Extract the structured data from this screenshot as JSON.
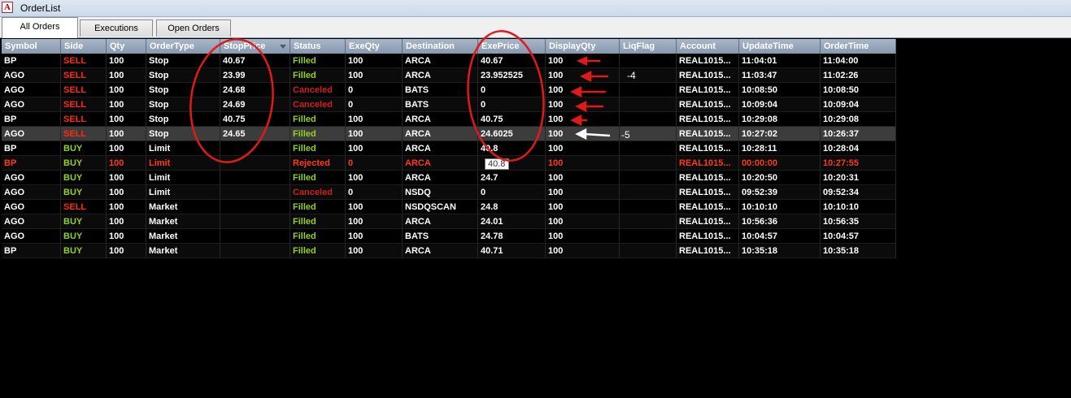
{
  "window": {
    "title": "OrderList"
  },
  "tabs": [
    "All Orders",
    "Executions",
    "Open Orders"
  ],
  "columns": [
    "Symbol",
    "Side",
    "Qty",
    "OrderType",
    "StopPrice",
    "Status",
    "ExeQty",
    "Destination",
    "ExePrice",
    "DisplayQty",
    "LiqFlag",
    "Account",
    "UpdateTime",
    "OrderTime"
  ],
  "rows": [
    {
      "symbol": "BP",
      "side": "SELL",
      "qty": "100",
      "ordertype": "Stop",
      "stopprice": "40.67",
      "status": "Filled",
      "exeqty": "100",
      "destination": "ARCA",
      "exeprice": "40.67",
      "displayqty": "100",
      "liqflag": "",
      "account": "REAL1015...",
      "updatetime": "11:04:01",
      "ordertime": "11:04:00"
    },
    {
      "symbol": "AGO",
      "side": "SELL",
      "qty": "100",
      "ordertype": "Stop",
      "stopprice": "23.99",
      "status": "Filled",
      "exeqty": "100",
      "destination": "ARCA",
      "exeprice": "23.952525",
      "displayqty": "100",
      "liqflag": "",
      "account": "REAL1015...",
      "updatetime": "11:03:47",
      "ordertime": "11:02:26"
    },
    {
      "symbol": "AGO",
      "side": "SELL",
      "qty": "100",
      "ordertype": "Stop",
      "stopprice": "24.68",
      "status": "Canceled",
      "exeqty": "0",
      "destination": "BATS",
      "exeprice": "0",
      "displayqty": "100",
      "liqflag": "",
      "account": "REAL1015...",
      "updatetime": "10:08:50",
      "ordertime": "10:08:50"
    },
    {
      "symbol": "AGO",
      "side": "SELL",
      "qty": "100",
      "ordertype": "Stop",
      "stopprice": "24.69",
      "status": "Canceled",
      "exeqty": "0",
      "destination": "BATS",
      "exeprice": "0",
      "displayqty": "100",
      "liqflag": "",
      "account": "REAL1015...",
      "updatetime": "10:09:04",
      "ordertime": "10:09:04"
    },
    {
      "symbol": "BP",
      "side": "SELL",
      "qty": "100",
      "ordertype": "Stop",
      "stopprice": "40.75",
      "status": "Filled",
      "exeqty": "100",
      "destination": "ARCA",
      "exeprice": "40.75",
      "displayqty": "100",
      "liqflag": "",
      "account": "REAL1015...",
      "updatetime": "10:29:08",
      "ordertime": "10:29:08"
    },
    {
      "symbol": "AGO",
      "side": "SELL",
      "qty": "100",
      "ordertype": "Stop",
      "stopprice": "24.65",
      "status": "Filled",
      "exeqty": "100",
      "destination": "ARCA",
      "exeprice": "24.6025",
      "displayqty": "100",
      "liqflag": "",
      "account": "REAL1015...",
      "updatetime": "10:27:02",
      "ordertime": "10:26:37"
    },
    {
      "symbol": "BP",
      "side": "BUY",
      "qty": "100",
      "ordertype": "Limit",
      "stopprice": "",
      "status": "Filled",
      "exeqty": "100",
      "destination": "ARCA",
      "exeprice": "40.8",
      "displayqty": "100",
      "liqflag": "",
      "account": "REAL1015...",
      "updatetime": "10:28:11",
      "ordertime": "10:28:04"
    },
    {
      "symbol": "BP",
      "side": "BUY",
      "qty": "100",
      "ordertype": "Limit",
      "stopprice": "",
      "status": "Rejected",
      "exeqty": "0",
      "destination": "ARCA",
      "exeprice": "",
      "displayqty": "100",
      "liqflag": "",
      "account": "REAL1015...",
      "updatetime": "00:00:00",
      "ordertime": "10:27:55"
    },
    {
      "symbol": "AGO",
      "side": "BUY",
      "qty": "100",
      "ordertype": "Limit",
      "stopprice": "",
      "status": "Filled",
      "exeqty": "100",
      "destination": "ARCA",
      "exeprice": "24.7",
      "displayqty": "100",
      "liqflag": "",
      "account": "REAL1015...",
      "updatetime": "10:20:50",
      "ordertime": "10:20:31"
    },
    {
      "symbol": "AGO",
      "side": "BUY",
      "qty": "100",
      "ordertype": "Limit",
      "stopprice": "",
      "status": "Canceled",
      "exeqty": "0",
      "destination": "NSDQ",
      "exeprice": "0",
      "displayqty": "100",
      "liqflag": "",
      "account": "REAL1015...",
      "updatetime": "09:52:39",
      "ordertime": "09:52:34"
    },
    {
      "symbol": "AGO",
      "side": "SELL",
      "qty": "100",
      "ordertype": "Market",
      "stopprice": "",
      "status": "Filled",
      "exeqty": "100",
      "destination": "NSDQSCAN",
      "exeprice": "24.8",
      "displayqty": "100",
      "liqflag": "",
      "account": "REAL1015...",
      "updatetime": "10:10:10",
      "ordertime": "10:10:10"
    },
    {
      "symbol": "AGO",
      "side": "BUY",
      "qty": "100",
      "ordertype": "Market",
      "stopprice": "",
      "status": "Filled",
      "exeqty": "100",
      "destination": "ARCA",
      "exeprice": "24.01",
      "displayqty": "100",
      "liqflag": "",
      "account": "REAL1015...",
      "updatetime": "10:56:36",
      "ordertime": "10:56:35"
    },
    {
      "symbol": "AGO",
      "side": "BUY",
      "qty": "100",
      "ordertype": "Market",
      "stopprice": "",
      "status": "Filled",
      "exeqty": "100",
      "destination": "BATS",
      "exeprice": "24.78",
      "displayqty": "100",
      "liqflag": "",
      "account": "REAL1015...",
      "updatetime": "10:04:57",
      "ordertime": "10:04:57"
    },
    {
      "symbol": "BP",
      "side": "BUY",
      "qty": "100",
      "ordertype": "Market",
      "stopprice": "",
      "status": "Filled",
      "exeqty": "100",
      "destination": "ARCA",
      "exeprice": "40.71",
      "displayqty": "100",
      "liqflag": "",
      "account": "REAL1015...",
      "updatetime": "10:35:18",
      "ordertime": "10:35:18"
    }
  ],
  "tooltip": "40.8",
  "annotations": {
    "note_a": "-4",
    "note_b": "-5"
  },
  "colors": {
    "sell": "#ff2a12",
    "buy": "#93d026",
    "filled": "#93d026",
    "canceled": "#d01e1e",
    "rejected": "#ff3a1a",
    "annotation_red": "#e11919"
  },
  "icons": {
    "app": "app-logo-icon",
    "sort": "sort-descending-icon"
  }
}
